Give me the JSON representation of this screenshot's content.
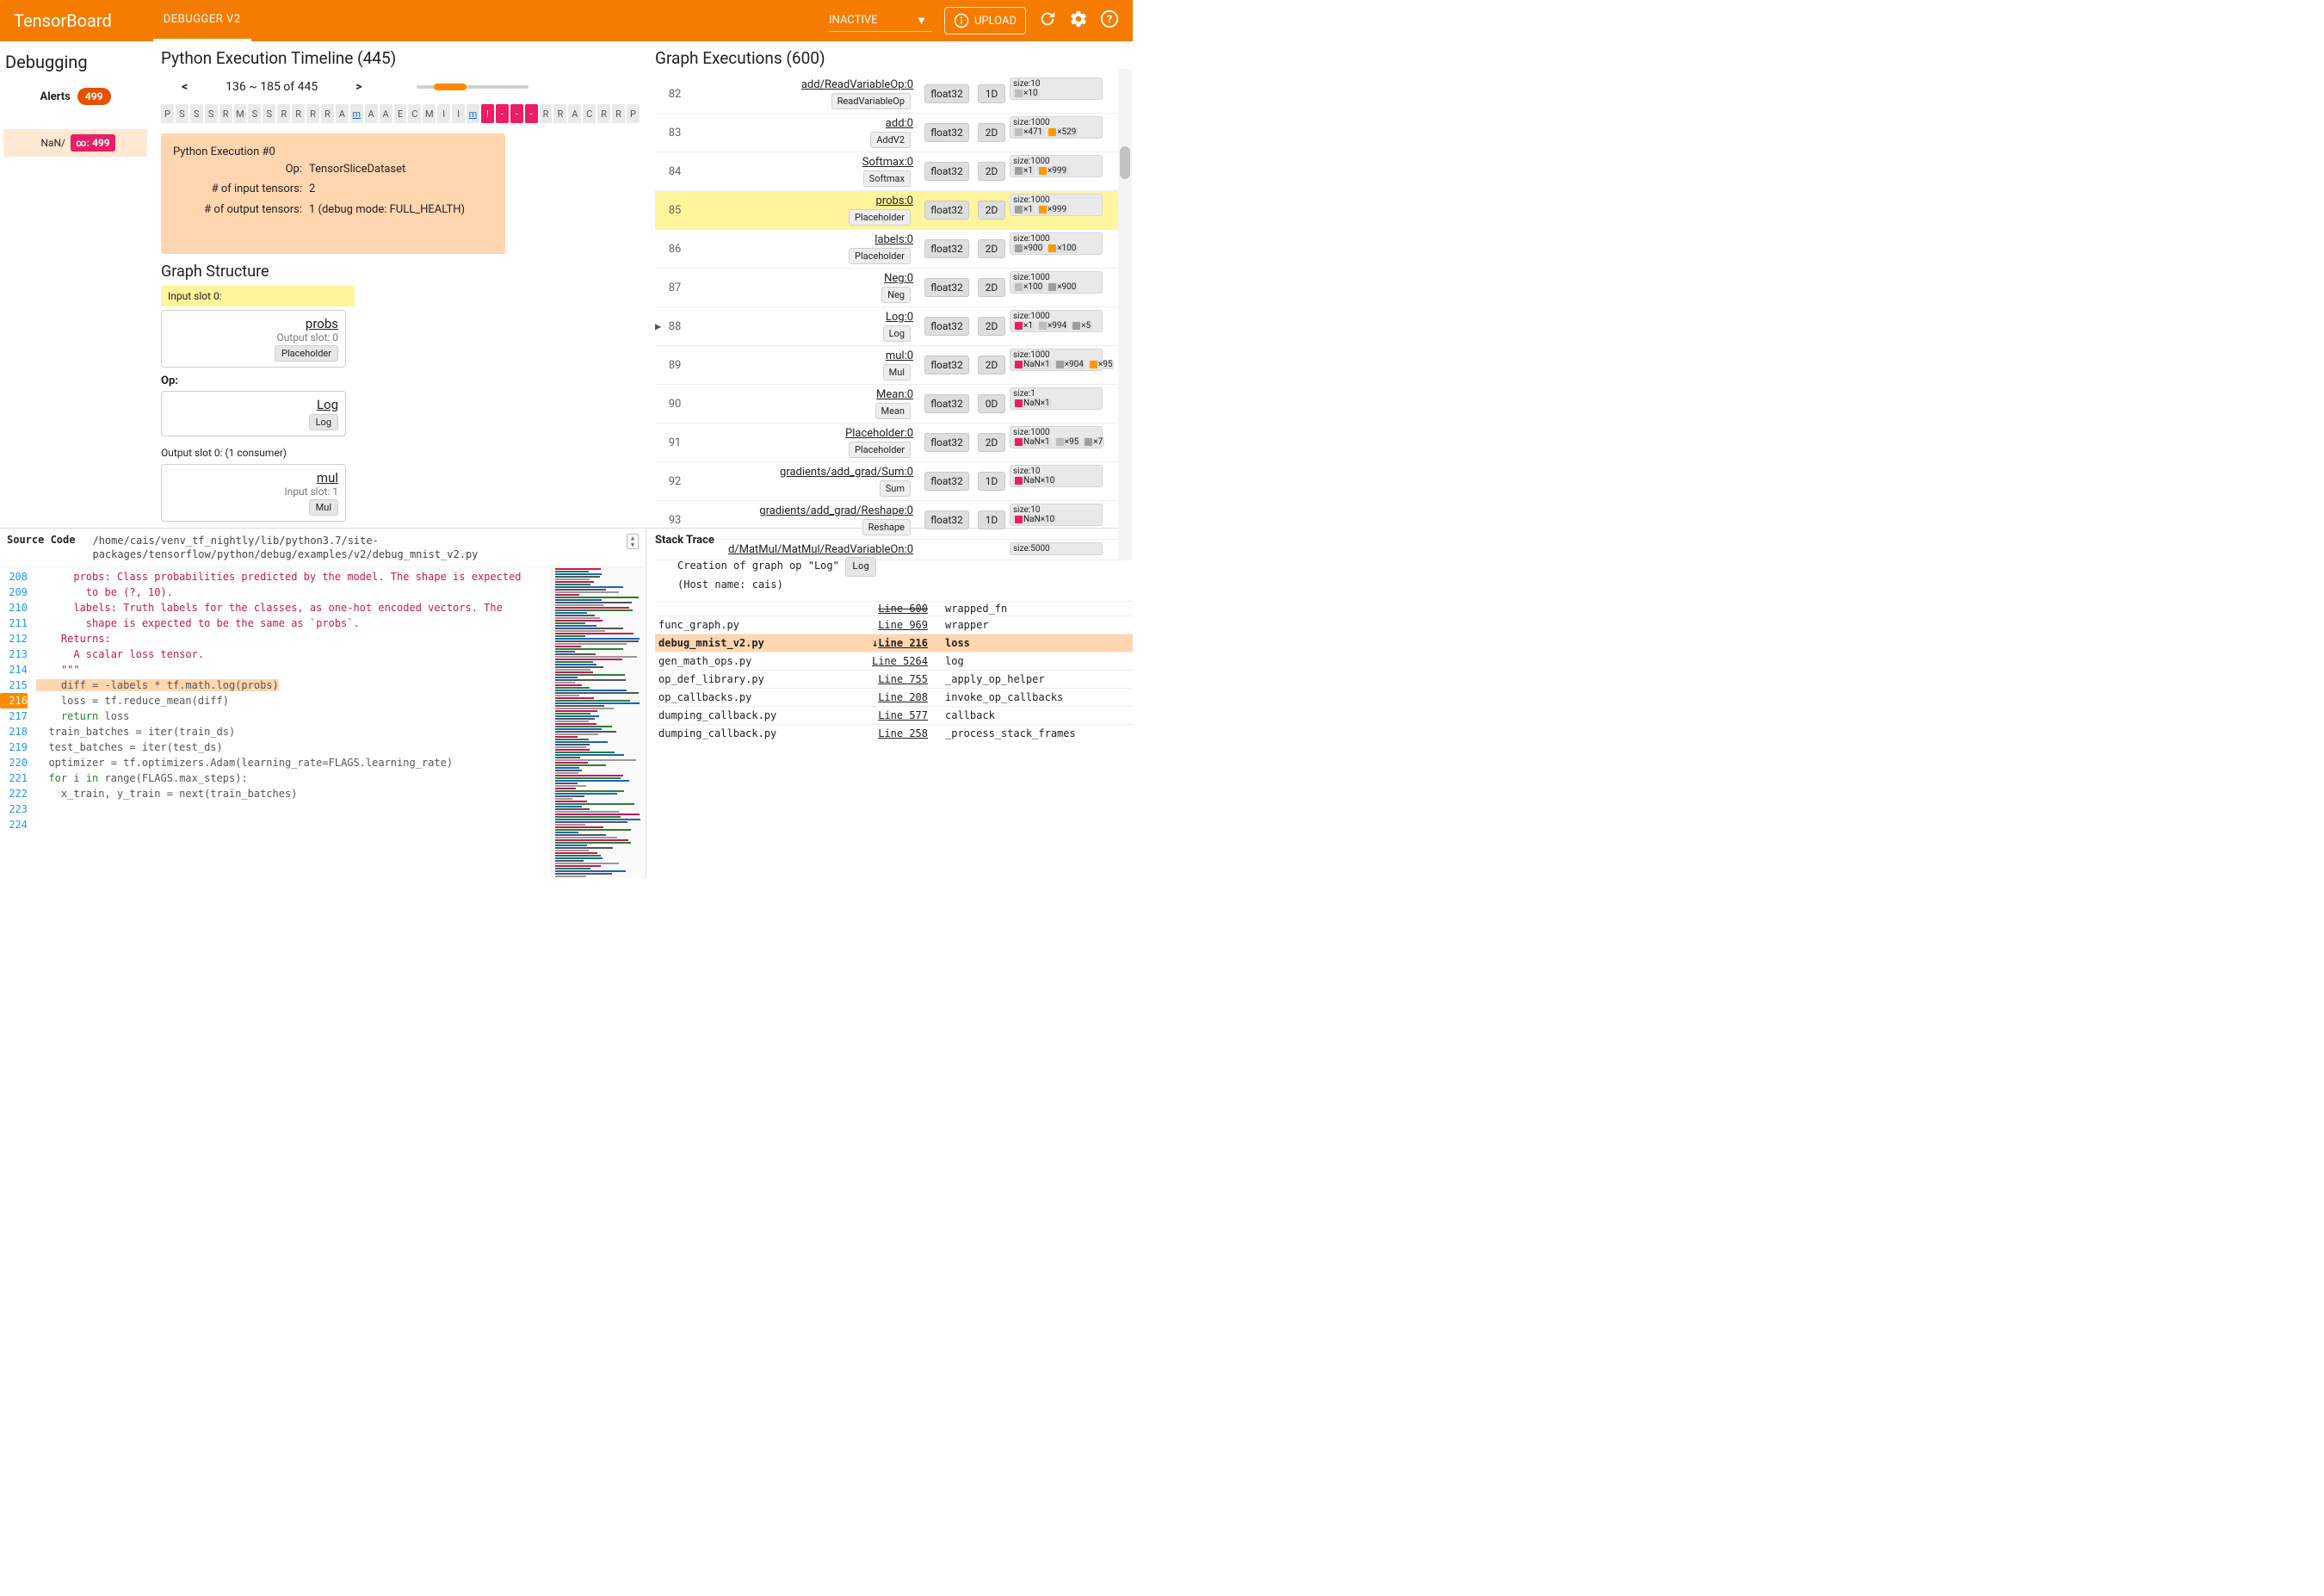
{
  "header": {
    "brand": "TensorBoard",
    "tab": "DEBUGGER V2",
    "dropdown": "INACTIVE",
    "upload": "UPLOAD"
  },
  "sidebar": {
    "title": "Debugging",
    "alerts_label": "Alerts",
    "alerts_count": "499",
    "nan_label": "NaN/",
    "nan_badge": "∞: 499"
  },
  "timeline": {
    "title": "Python Execution Timeline (445)",
    "range": "136 ~ 185 of 445",
    "cells": [
      "P",
      "S",
      "S",
      "S",
      "R",
      "M",
      "S",
      "S",
      "R",
      "R",
      "R",
      "R",
      "A",
      "m",
      "A",
      "A",
      "E",
      "C",
      "M",
      "I",
      "I",
      "m",
      "!",
      "-",
      "-",
      "-",
      "R",
      "R",
      "A",
      "C",
      "R",
      "R",
      "P"
    ],
    "pink_idx": [
      22,
      23,
      24,
      25
    ],
    "link_idx": [
      13,
      21
    ],
    "detail": {
      "heading": "Python Execution #0",
      "op_k": "Op:",
      "op_v": "TensorSliceDataset",
      "in_k": "# of input tensors:",
      "in_v": "2",
      "out_k": "# of output tensors:",
      "out_v": "1   (debug mode: FULL_HEALTH)"
    }
  },
  "graph_struct": {
    "title": "Graph Structure",
    "input_slot_label": "Input slot 0:",
    "input_node": {
      "name": "probs",
      "sub": "Output slot: 0",
      "chip": "Placeholder"
    },
    "op_label": "Op:",
    "op_node": {
      "name": "Log",
      "chip": "Log"
    },
    "output_slot_label": "Output slot 0: (1 consumer)",
    "output_node": {
      "name": "mul",
      "sub": "Input slot: 1",
      "chip": "Mul"
    }
  },
  "graph_exec": {
    "title": "Graph Executions (600)",
    "rows": [
      {
        "idx": "82",
        "name": "add/ReadVariableOp:0",
        "chip": "ReadVariableOp",
        "dtype": "float32",
        "rank": "1D",
        "size": "size:10",
        "tok": [
          [
            "grey",
            "×10"
          ]
        ]
      },
      {
        "idx": "83",
        "name": "add:0",
        "chip": "AddV2",
        "dtype": "float32",
        "rank": "2D",
        "size": "size:1000",
        "tok": [
          [
            "grey",
            "×471"
          ],
          [
            "plus",
            "×529"
          ]
        ]
      },
      {
        "idx": "84",
        "name": "Softmax:0",
        "chip": "Softmax",
        "dtype": "float32",
        "rank": "2D",
        "size": "size:1000",
        "tok": [
          [
            "zero",
            "×1"
          ],
          [
            "plus",
            "×999"
          ]
        ]
      },
      {
        "idx": "85",
        "name": "probs:0",
        "chip": "Placeholder",
        "dtype": "float32",
        "rank": "2D",
        "size": "size:1000",
        "tok": [
          [
            "zero",
            "×1"
          ],
          [
            "plus",
            "×999"
          ]
        ],
        "sel": true
      },
      {
        "idx": "86",
        "name": "labels:0",
        "chip": "Placeholder",
        "dtype": "float32",
        "rank": "2D",
        "size": "size:1000",
        "tok": [
          [
            "zero",
            "×900"
          ],
          [
            "plus",
            "×100"
          ]
        ]
      },
      {
        "idx": "87",
        "name": "Neg:0",
        "chip": "Neg",
        "dtype": "float32",
        "rank": "2D",
        "size": "size:1000",
        "tok": [
          [
            "grey",
            "×100"
          ],
          [
            "zero",
            "×900"
          ]
        ]
      },
      {
        "idx": "88",
        "name": "Log:0",
        "chip": "Log",
        "dtype": "float32",
        "rank": "2D",
        "size": "size:1000",
        "tok": [
          [
            "inf",
            "×1"
          ],
          [
            "grey",
            "×994"
          ],
          [
            "zero",
            "×5"
          ]
        ],
        "play": true
      },
      {
        "idx": "89",
        "name": "mul:0",
        "chip": "Mul",
        "dtype": "float32",
        "rank": "2D",
        "size": "size:1000",
        "tok": [
          [
            "nan",
            "NaN×1"
          ],
          [
            "zero",
            "×904"
          ],
          [
            "plus",
            "×95"
          ]
        ]
      },
      {
        "idx": "90",
        "name": "Mean:0",
        "chip": "Mean",
        "dtype": "float32",
        "rank": "0D",
        "size": "size:1",
        "tok": [
          [
            "nan",
            "NaN×1"
          ]
        ]
      },
      {
        "idx": "91",
        "name": "Placeholder:0",
        "chip": "Placeholder",
        "dtype": "float32",
        "rank": "2D",
        "size": "size:1000",
        "tok": [
          [
            "nan",
            "NaN×1"
          ],
          [
            "grey",
            "×95"
          ],
          [
            "zero",
            "×7"
          ]
        ]
      },
      {
        "idx": "92",
        "name": "gradients/add_grad/Sum:0",
        "chip": "Sum",
        "dtype": "float32",
        "rank": "1D",
        "size": "size:10",
        "tok": [
          [
            "nan",
            "NaN×10"
          ]
        ]
      },
      {
        "idx": "93",
        "name": "gradients/add_grad/Reshape:0",
        "chip": "Reshape",
        "dtype": "float32",
        "rank": "1D",
        "size": "size:10",
        "tok": [
          [
            "nan",
            "NaN×10"
          ]
        ]
      },
      {
        "idx": "",
        "name": "d/MatMul/MatMul/ReadVariableOn:0",
        "chip": "",
        "dtype": "",
        "rank": "",
        "size": "size:5000",
        "tok": []
      }
    ]
  },
  "source": {
    "label": "Source Code",
    "path1": "/home/cais/venv_tf_nightly/lib/python3.7/site-",
    "path2": "packages/tensorflow/python/debug/examples/v2/debug_mnist_v2.py",
    "lines": [
      {
        "n": 208,
        "t": "      probs: Class probabilities predicted by the model. The shape is expected",
        "c": "str"
      },
      {
        "n": 209,
        "t": "        to be (?, 10).",
        "c": "str"
      },
      {
        "n": 210,
        "t": "      labels: Truth labels for the classes, as one-hot encoded vectors. The",
        "c": "str"
      },
      {
        "n": 211,
        "t": "        shape is expected to be the same as `probs`.",
        "c": "str"
      },
      {
        "n": 212,
        "t": "",
        "c": ""
      },
      {
        "n": 213,
        "t": "    Returns:",
        "c": "str"
      },
      {
        "n": 214,
        "t": "      A scalar loss tensor.",
        "c": "str"
      },
      {
        "n": 215,
        "t": "    \"\"\"",
        "c": "str"
      },
      {
        "n": 216,
        "t": "    diff = -labels * tf.math.log(probs)",
        "c": "hl"
      },
      {
        "n": 217,
        "t": "    loss = tf.reduce_mean(diff)",
        "c": ""
      },
      {
        "n": 218,
        "t": "    return loss",
        "c": "kw"
      },
      {
        "n": 219,
        "t": "",
        "c": ""
      },
      {
        "n": 220,
        "t": "  train_batches = iter(train_ds)",
        "c": ""
      },
      {
        "n": 221,
        "t": "  test_batches = iter(test_ds)",
        "c": ""
      },
      {
        "n": 222,
        "t": "  optimizer = tf.optimizers.Adam(learning_rate=FLAGS.learning_rate)",
        "c": ""
      },
      {
        "n": 223,
        "t": "  for i in range(FLAGS.max_steps):",
        "c": "kw"
      },
      {
        "n": 224,
        "t": "    x_train, y_train = next(train_batches)",
        "c": ""
      }
    ]
  },
  "stack": {
    "title": "Stack Trace",
    "creation_a": "Creation of graph op \"Log\"",
    "creation_chip": "Log",
    "creation_b": "(Host name: cais)",
    "rows": [
      {
        "file": "",
        "line": "Line 600",
        "fn": "wrapped_fn",
        "strike": true
      },
      {
        "file": "func_graph.py",
        "line": "Line 969",
        "fn": "wrapper"
      },
      {
        "file": "debug_mnist_v2.py",
        "line": "Line 216",
        "fn": "loss",
        "sel": true,
        "arrow": true
      },
      {
        "file": "gen_math_ops.py",
        "line": "Line 5264",
        "fn": "log"
      },
      {
        "file": "op_def_library.py",
        "line": "Line 755",
        "fn": "_apply_op_helper"
      },
      {
        "file": "op_callbacks.py",
        "line": "Line 208",
        "fn": "invoke_op_callbacks"
      },
      {
        "file": "dumping_callback.py",
        "line": "Line 577",
        "fn": "callback"
      },
      {
        "file": "dumping_callback.py",
        "line": "Line 258",
        "fn": "_process_stack_frames"
      }
    ]
  }
}
